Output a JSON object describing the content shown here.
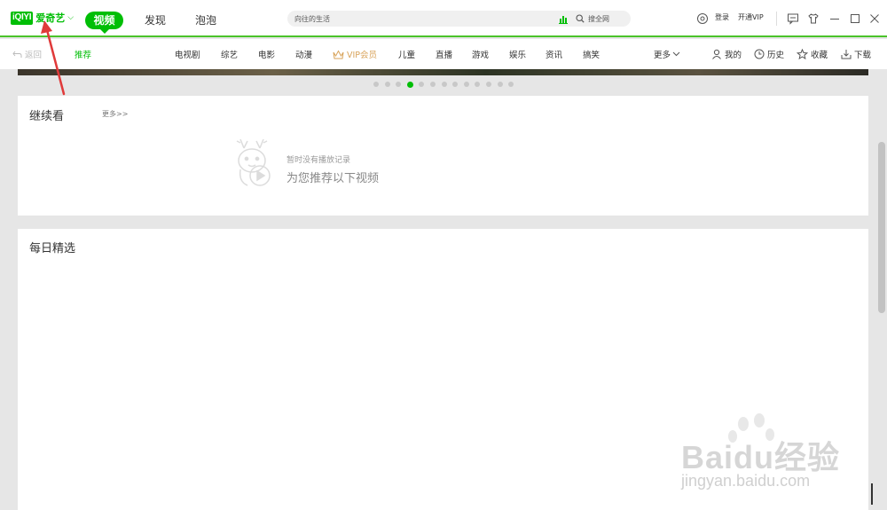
{
  "app": {
    "logo_mark": "iQIYI",
    "logo_text": "爱奇艺",
    "logo_caret": "⌵"
  },
  "main_tabs": [
    {
      "label": "视频",
      "active": true
    },
    {
      "label": "发现",
      "active": false
    },
    {
      "label": "泡泡",
      "active": false
    }
  ],
  "search": {
    "value": "向往的生活",
    "button_label": "搜全网"
  },
  "titlebar": {
    "login": "登录",
    "vip": "开通VIP",
    "icons": [
      "settings-icon",
      "message-icon",
      "skin-icon",
      "minimize-icon",
      "maximize-icon",
      "close-icon"
    ]
  },
  "subnav": {
    "back": "返回",
    "recommend": "推荐",
    "categories": [
      "电视剧",
      "综艺",
      "电影",
      "动漫",
      "VIP会员",
      "儿童",
      "直播",
      "游戏",
      "娱乐",
      "资讯",
      "搞笑"
    ],
    "more": "更多",
    "right": [
      {
        "label": "我的",
        "icon": "user-icon"
      },
      {
        "label": "历史",
        "icon": "clock-icon"
      },
      {
        "label": "收藏",
        "icon": "star-icon"
      },
      {
        "label": "下载",
        "icon": "download-icon"
      }
    ]
  },
  "carousel": {
    "count": 13,
    "active_index": 3
  },
  "continue_watching": {
    "title": "继续看",
    "more": "更多>>",
    "empty_line1": "暂时没有播放记录",
    "empty_line2": "为您推荐以下视频"
  },
  "daily_picks": {
    "title": "每日精选"
  },
  "colors": {
    "brand": "#00be06",
    "vip": "#d8a35a",
    "annotation": "#e03a3a"
  },
  "watermark": {
    "text": "Baidu经验",
    "url": "jingyan.baidu.com"
  }
}
